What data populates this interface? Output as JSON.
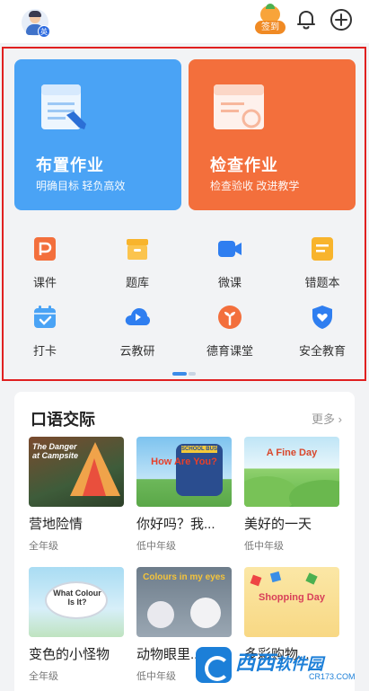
{
  "header": {
    "avatar_badge": "英",
    "checkin_label": "签到",
    "icons": [
      "avatar",
      "fruit-checkin-icon",
      "bell-icon",
      "plus-circle-icon"
    ]
  },
  "feature_cards": [
    {
      "title": "布置作业",
      "subtitle": "明确目标 轻负高效",
      "color": "#4aa3f5",
      "icon": "document-pencil-icon"
    },
    {
      "title": "检查作业",
      "subtitle": "检查验收 改进教学",
      "color": "#f36f3c",
      "icon": "notebook-check-icon"
    }
  ],
  "grid": [
    {
      "label": "课件",
      "icon": "courseware-icon",
      "color": "#f36f3c"
    },
    {
      "label": "题库",
      "icon": "question-bank-icon",
      "color": "#f8b42c"
    },
    {
      "label": "微课",
      "icon": "video-camera-icon",
      "color": "#2f7ef0"
    },
    {
      "label": "错题本",
      "icon": "mistake-book-icon",
      "color": "#f8b42c"
    },
    {
      "label": "打卡",
      "icon": "calendar-check-icon",
      "color": "#4aa3f5"
    },
    {
      "label": "云教研",
      "icon": "cloud-play-icon",
      "color": "#2f7ef0"
    },
    {
      "label": "德育课堂",
      "icon": "sprout-icon",
      "color": "#f36f3c"
    },
    {
      "label": "安全教育",
      "icon": "shield-heart-icon",
      "color": "#2f7ef0"
    }
  ],
  "oral": {
    "title": "口语交际",
    "more": "更多",
    "items": [
      {
        "name": "营地险情",
        "grade": "全年级",
        "thumb_text": "The Danger at Campsite"
      },
      {
        "name": "你好吗？我...",
        "grade": "低中年级",
        "thumb_text": "How Are You?",
        "thumb_text2": "SCHOOL BUS"
      },
      {
        "name": "美好的一天",
        "grade": "低中年级",
        "thumb_text": "A Fine Day"
      },
      {
        "name": "变色的小怪物",
        "grade": "全年级",
        "thumb_text": "What Colour Is It?"
      },
      {
        "name": "动物眼里...",
        "grade": "低中年级",
        "thumb_text": "Colours in my eyes"
      },
      {
        "name": "多彩购物...",
        "grade": "",
        "thumb_text": "Shopping Day"
      }
    ]
  },
  "watermark": {
    "brand": "西西",
    "domain_text": "软件园",
    "url": "CR173.COM"
  }
}
